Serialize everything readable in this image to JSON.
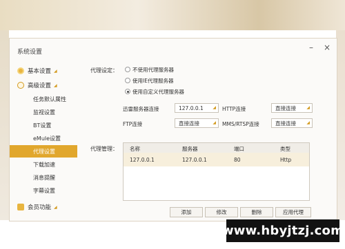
{
  "dialog": {
    "title": "系统设置"
  },
  "window_controls": {
    "minimize": "–",
    "close": "×"
  },
  "sidebar": {
    "sections": [
      {
        "label": "基本设置",
        "icon": "gear-icon"
      },
      {
        "label": "高级设置",
        "icon": "clock-icon"
      },
      {
        "label": "会员功能",
        "icon": "vip-icon"
      }
    ],
    "items": [
      {
        "label": "任务默认属性"
      },
      {
        "label": "监视设置"
      },
      {
        "label": "BT设置"
      },
      {
        "label": "eMule设置"
      },
      {
        "label": "代理设置"
      },
      {
        "label": "下载加速"
      },
      {
        "label": "消息提醒"
      },
      {
        "label": "字幕设置"
      }
    ]
  },
  "proxy": {
    "settings_label": "代理设定：",
    "options": [
      {
        "label": "不使用代理服务器",
        "selected": false
      },
      {
        "label": "使用IE代理服务器",
        "selected": false
      },
      {
        "label": "使用自定义代理服务器",
        "selected": true
      }
    ],
    "fields": {
      "thunder_label": "迅雷服务器连接",
      "thunder_value": "127.0.0.1",
      "http_label": "HTTP连接",
      "http_value": "直接连接",
      "ftp_label": "FTP连接",
      "ftp_value": "直接连接",
      "mms_label": "MMS/RTSP连接",
      "mms_value": "直接连接"
    },
    "manage_label": "代理管理：",
    "table": {
      "columns": [
        "名称",
        "服务器",
        "端口",
        "类型"
      ],
      "rows": [
        [
          "127.0.0.1",
          "127.0.0.1",
          "80",
          "Http"
        ]
      ]
    },
    "buttons": {
      "add": "添加",
      "edit": "修改",
      "delete": "删除",
      "apply": "应用代理"
    }
  },
  "watermark": "www.hbyjtzj.com",
  "colors": {
    "accent": "#e1a72d",
    "selected_row": "#f7efdc"
  }
}
